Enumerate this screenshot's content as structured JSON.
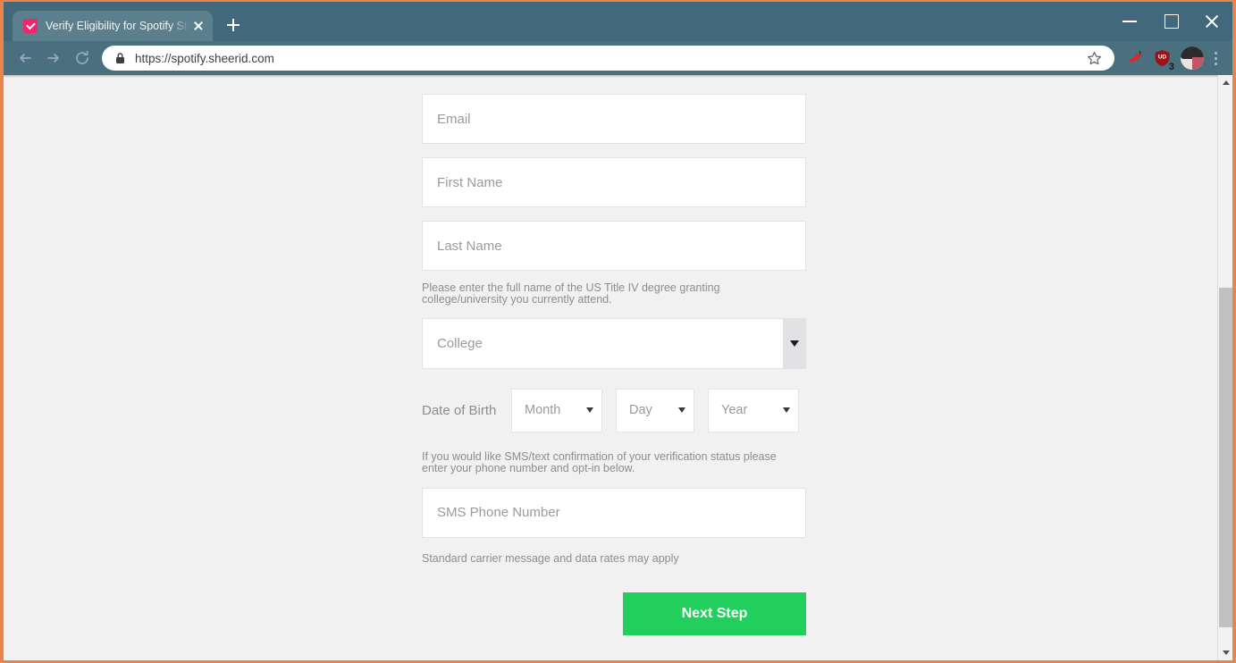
{
  "browser": {
    "tab": {
      "title": "Verify Eligibility for Spotify Stude",
      "favicon": "sheerid-favicon-icon",
      "close": "close-tab-icon"
    },
    "new_tab_label": "+",
    "window_controls": {
      "minimize": "minimize-icon",
      "maximize": "maximize-icon",
      "close": "close-window-icon"
    },
    "toolbar": {
      "back": "back-arrow-icon",
      "forward": "forward-arrow-icon",
      "reload": "reload-icon",
      "lock": "lock-icon",
      "url": "https://spotify.sheerid.com",
      "bookmark": "star-icon",
      "extensions": [
        {
          "name": "chili-pepper-extension-icon",
          "badge": ""
        },
        {
          "name": "ud-shield-extension-icon",
          "label": "UD",
          "badge": "3"
        }
      ],
      "profile": "profile-avatar",
      "menu": "three-dot-menu-icon"
    }
  },
  "page": {
    "fields": {
      "email_placeholder": "Email",
      "first_name_placeholder": "First Name",
      "last_name_placeholder": "Last Name",
      "college_placeholder": "College",
      "sms_placeholder": "SMS Phone Number"
    },
    "college_helper": "Please enter the full name of the US Title IV degree granting college/university you currently attend.",
    "dob": {
      "label": "Date of Birth",
      "month_placeholder": "Month",
      "day_placeholder": "Day",
      "year_placeholder": "Year"
    },
    "sms_helper": "If you would like SMS/text confirmation of your verification status please enter your phone number and opt-in below.",
    "carrier_note": "Standard carrier message and data rates may apply",
    "submit_label": "Next Step",
    "colors": {
      "submit_green": "#22cf5d",
      "page_background": "#f1f1f2",
      "placeholder_gray": "#9a9a9f"
    }
  }
}
